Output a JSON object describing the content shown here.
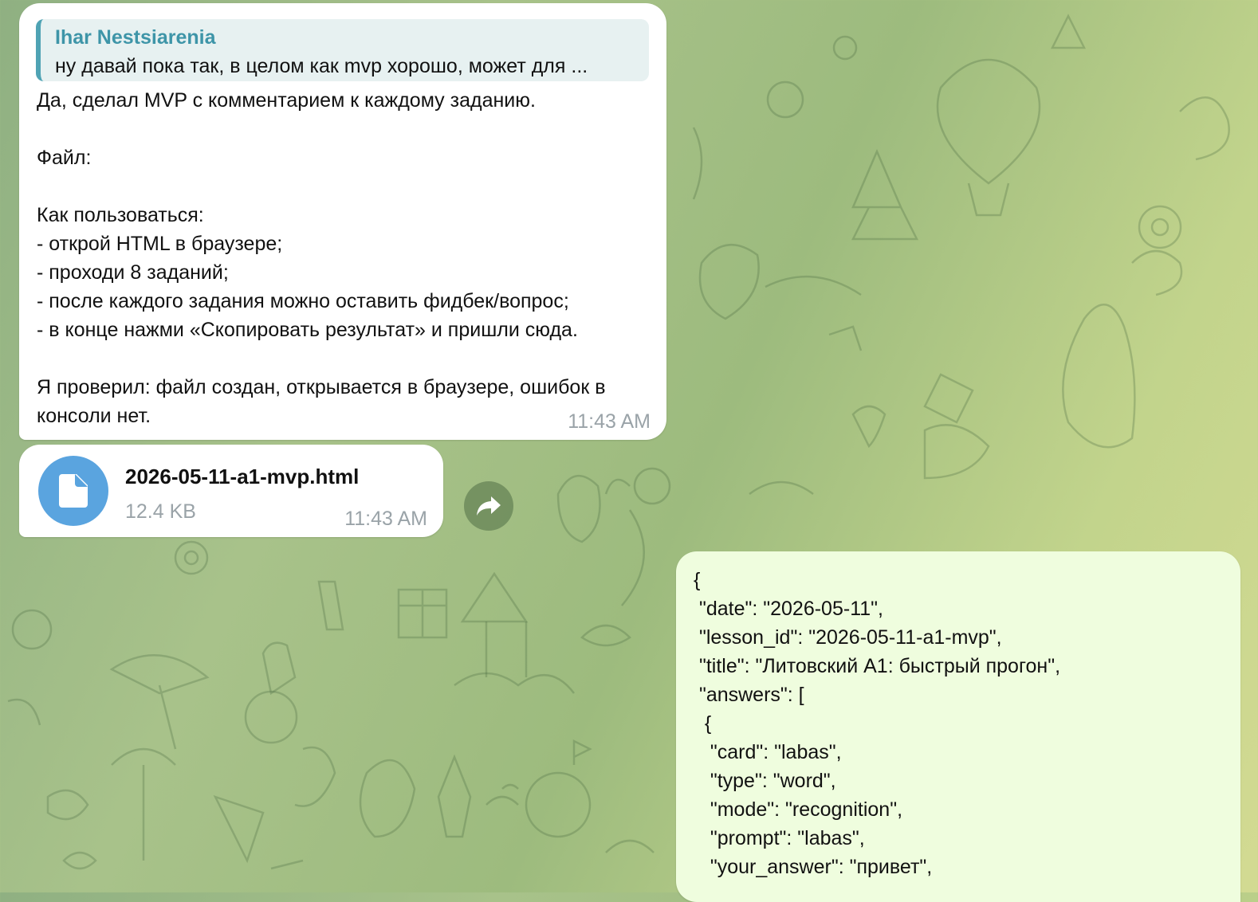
{
  "colors": {
    "reply_accent": "#3e95a8",
    "file_icon_bg": "#5aa4df",
    "outgoing_bubble": "#effdde",
    "incoming_bubble": "#ffffff",
    "timestamp": "#9aa3a8"
  },
  "message_1": {
    "reply": {
      "author": "Ihar Nestsiarenia",
      "text": "ну давай пока так, в целом как mvp хорошо, может для ..."
    },
    "body": "Да, сделал MVP с комментарием к каждому заданию.\n\nФайл:\n\nКак пользоваться:\n- открой HTML в браузере;\n- проходи 8 заданий;\n- после каждого задания можно оставить фидбек/вопрос;\n- в конце нажми «Скопировать результат» и пришли сюда.\n\nЯ проверил: файл создан, открывается в браузере, ошибок в консоли нет.",
    "time": "11:43 AM"
  },
  "message_2": {
    "file_icon": "document-icon",
    "file_name": "2026-05-11-a1-mvp.html",
    "file_size": "12.4 KB",
    "time": "11:43 AM"
  },
  "forward_icon": "forward-arrow-icon",
  "message_3": {
    "lines": [
      "{",
      " \"date\": \"2026-05-11\",",
      " \"lesson_id\": \"2026-05-11-a1-mvp\",",
      " \"title\": \"Литовский A1: быстрый прогон\",",
      " \"answers\": [",
      "  {",
      "   \"card\": \"labas\",",
      "   \"type\": \"word\",",
      "   \"mode\": \"recognition\",",
      "   \"prompt\": \"labas\",",
      "   \"your_answer\": \"привет\","
    ]
  }
}
